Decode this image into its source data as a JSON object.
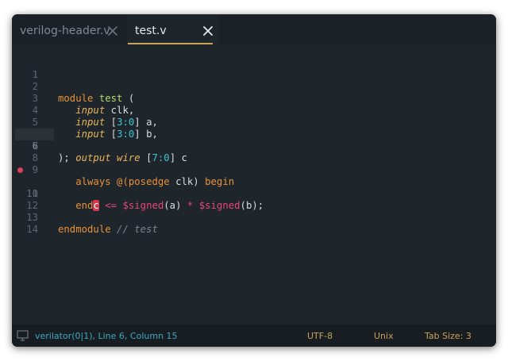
{
  "tabs": [
    {
      "label": "verilog-header.v",
      "active": false
    },
    {
      "label": "test.v",
      "active": true
    }
  ],
  "editor": {
    "current_line": 6,
    "breakpoint_line": 10,
    "line_numbers": [
      "1",
      "2",
      "3",
      "4",
      "5",
      "6",
      "7",
      "8",
      "9",
      "10",
      "11",
      "12",
      "13",
      "14"
    ],
    "tokens": {
      "l2_module": "module",
      "l2_name": "test",
      "l2_rest": " (",
      "l3_kw": "input",
      "l3_rest": " clk,",
      "l4_kw": "input",
      "l4_b1": " [",
      "l4_n1": "3",
      "l4_c": ":",
      "l4_n2": "0",
      "l4_rest": "] a,",
      "l5_kw": "input",
      "l5_b1": " [",
      "l5_n1": "3",
      "l5_c": ":",
      "l5_n2": "0",
      "l5_rest": "] b,",
      "l6_kw1": "output",
      "l6_sp": " ",
      "l6_kw2": "wire",
      "l6_b1": " [",
      "l6_n1": "7",
      "l6_c": ":",
      "l6_n2": "0",
      "l6_rest": "] c",
      "l7_text": ");",
      "l9_always": "always",
      "l9_at": " @(",
      "l9_posedge": "posedge",
      "l9_mid": " clk) ",
      "l9_begin": "begin",
      "l10_err": "c",
      "l10_sp": " ",
      "l10_op": "<=",
      "l10_sp2": " ",
      "l10_sys1": "$signed",
      "l10_arg1": "(a) ",
      "l10_mul": "*",
      "l10_sp3": " ",
      "l10_sys2": "$signed",
      "l10_arg2": "(b);",
      "l11_end": "end",
      "l13_endmodule": "endmodule",
      "l13_comment": " // test"
    }
  },
  "statusbar": {
    "icon": "monitor-icon",
    "message": "verilator(0|1), Line 6, Column 15",
    "encoding": "UTF-8",
    "line_endings": "Unix",
    "tab_size": "Tab Size: 3"
  },
  "colors": {
    "background": "#1e252b",
    "keyword": "#e8923a",
    "accent_tab": "#c9a45a",
    "error": "#e0405a",
    "status_text": "#c8a25a",
    "status_message": "#3aaac4"
  }
}
